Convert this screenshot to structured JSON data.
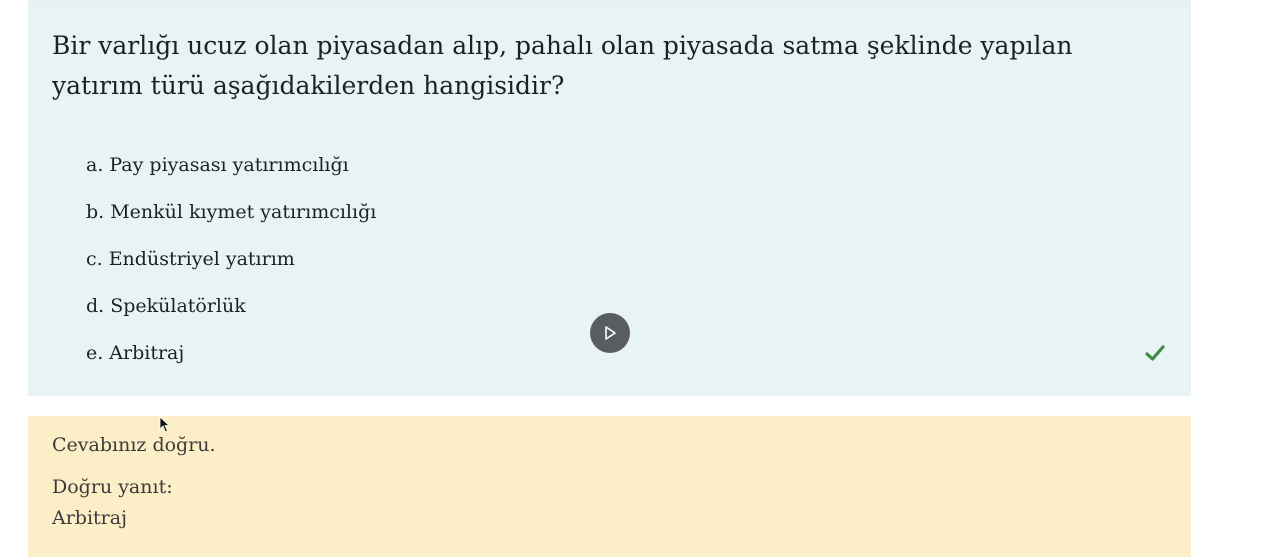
{
  "question": {
    "text": "Bir varlığı ucuz olan piyasadan alıp, pahalı olan piyasada satma şeklinde yapılan yatırım türü aşağıdakilerden hangisidir?",
    "answers": [
      {
        "letter": "a.",
        "text": "Pay piyasası yatırımcılığı",
        "correct": false
      },
      {
        "letter": "b.",
        "text": "Menkül kıymet yatırımcılığı",
        "correct": false
      },
      {
        "letter": "c.",
        "text": "Endüstriyel yatırım",
        "correct": false
      },
      {
        "letter": "d.",
        "text": "Spekülatörlük",
        "correct": false
      },
      {
        "letter": "e.",
        "text": "Arbitraj",
        "correct": true
      }
    ],
    "correct_icon": "checkmark-icon",
    "play_icon": "play-icon"
  },
  "feedback": {
    "status": "Cevabınız doğru.",
    "correct_label": "Doğru yanıt:",
    "correct_answer": "Arbitraj"
  },
  "colors": {
    "question_bg": "#e7f3f5",
    "feedback_bg": "#fcefc7",
    "check": "#3f8a3f",
    "play_bg": "#595d60"
  }
}
